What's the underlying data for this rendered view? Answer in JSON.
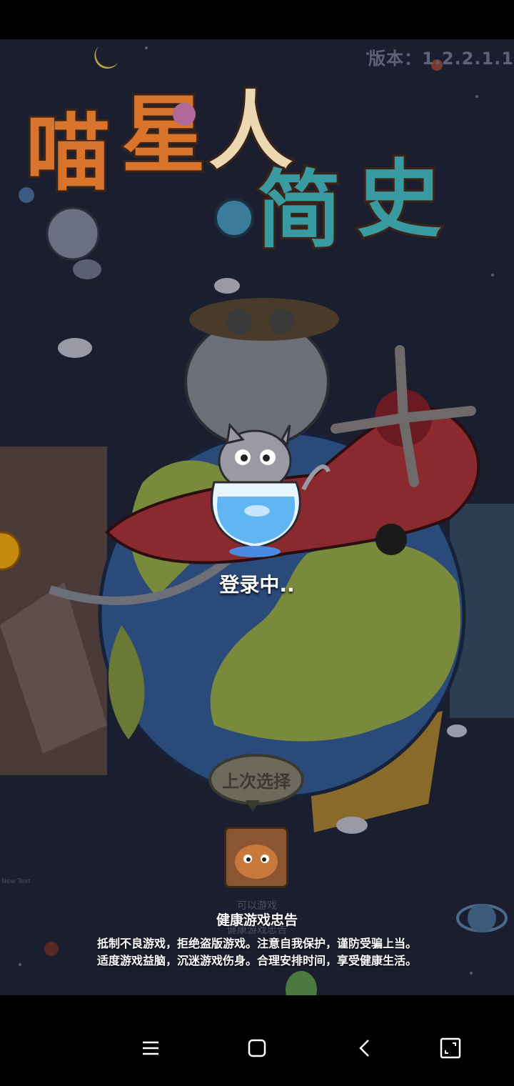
{
  "game": {
    "version": "版本：1.2.2.1.1",
    "loading": "登录中..",
    "last_choice": "上次选择",
    "ghost_line1": "可以游戏",
    "ghost_line2": "健康游戏忠告",
    "new_text": "New Text"
  },
  "advice": {
    "title": "健康游戏忠告",
    "line1": "抵制不良游戏，拒绝盗版游戏。注意自我保护，谨防受骗上当。",
    "line2": "适度游戏益脑，沉迷游戏伤身。合理安排时间，享受健康生活。"
  },
  "nav": {
    "menu_icon": "menu-icon",
    "home_icon": "home-icon",
    "back_icon": "back-icon",
    "screenshot_icon": "screenshot-icon"
  },
  "colors": {
    "background": "#1b1e2e",
    "text": "#ffffff",
    "planet_ocean": "#2a4a7a",
    "planet_land": "#7a8a3c",
    "plane_red": "#8a2a2e"
  }
}
